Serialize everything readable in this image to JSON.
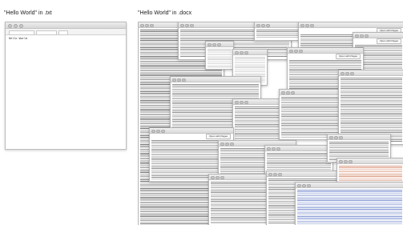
{
  "captions": {
    "left": "\"Hello World\" in .txt",
    "right": "\"Hello World\" in .docx"
  },
  "txt_window": {
    "body_text": "Hello World"
  },
  "docx_windows": {
    "open_with_button": "Open with Pages"
  }
}
